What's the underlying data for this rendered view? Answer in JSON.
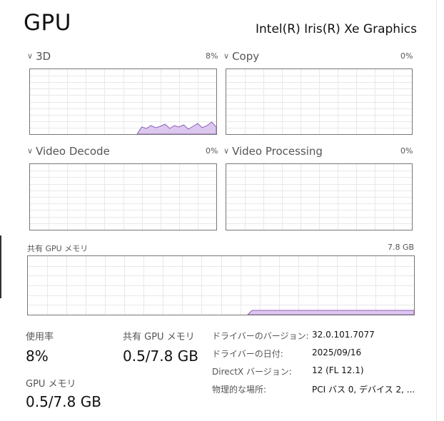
{
  "header": {
    "title": "GPU",
    "device_name": "Intel(R) Iris(R) Xe Graphics"
  },
  "engines": [
    {
      "label": "3D",
      "percent": "8%",
      "usage": [
        0,
        0,
        0,
        0,
        0,
        0,
        0,
        0,
        0,
        0,
        0,
        0,
        0,
        0,
        0,
        0,
        0,
        0,
        0,
        0,
        0,
        0,
        0,
        0,
        0,
        0,
        0,
        0,
        0,
        0,
        0,
        0,
        0,
        0,
        0,
        0,
        0,
        0,
        0,
        0,
        0,
        0,
        0,
        0,
        0,
        0,
        0,
        0,
        0,
        0,
        0,
        0,
        0,
        0,
        0,
        0,
        0,
        0,
        0,
        0,
        0,
        0,
        0,
        0,
        0,
        0,
        0,
        0,
        0,
        0,
        0,
        0,
        0,
        0,
        0,
        0,
        0,
        0,
        0,
        0,
        0,
        0,
        0,
        0,
        0,
        0,
        0,
        0,
        0,
        0,
        0,
        0,
        0,
        0,
        0,
        0,
        0,
        0,
        0,
        0,
        0,
        0,
        0,
        0,
        0,
        0,
        0,
        0,
        0,
        0,
        0,
        0,
        0,
        0,
        0,
        0,
        0,
        0,
        0,
        0,
        0,
        0,
        0,
        0,
        0,
        0,
        0,
        0,
        0,
        0,
        0,
        0,
        0,
        0,
        0,
        0,
        0,
        0,
        0,
        0,
        0,
        0,
        0,
        0,
        0,
        0,
        0,
        0,
        0,
        0,
        0,
        0,
        0,
        0,
        0,
        0,
        0,
        0,
        0,
        0,
        0,
        0,
        0,
        0,
        0,
        0,
        0,
        0,
        0,
        0,
        0,
        0,
        0,
        0,
        0,
        0,
        0,
        0,
        0,
        0,
        0,
        0,
        0,
        0,
        0,
        0,
        0,
        0,
        0,
        0,
        0,
        0,
        0,
        0,
        0,
        0,
        0,
        0,
        0,
        0,
        0,
        0,
        0,
        0,
        0,
        0,
        0,
        0,
        0,
        0,
        0,
        0,
        0,
        0,
        0,
        0,
        0,
        0,
        0,
        0,
        0,
        0,
        0,
        0,
        0,
        0,
        0,
        0,
        0,
        0,
        0,
        0,
        0,
        0,
        0,
        0,
        0,
        0,
        0,
        0,
        0,
        0,
        0,
        0,
        0,
        0,
        0,
        0,
        0,
        0,
        0,
        0,
        0,
        0,
        0,
        0,
        0,
        0,
        0,
        0,
        0,
        0
      ]
    },
    {
      "label": "Copy",
      "percent": "0%"
    },
    {
      "label": "Video Decode",
      "percent": "0%"
    },
    {
      "label": "Video Processing",
      "percent": "0%"
    }
  ],
  "shared_memory": {
    "label": "共有 GPU メモリ",
    "capacity": "7.8 GB"
  },
  "stats": {
    "utilization_label": "使用率",
    "utilization_value": "8%",
    "gpu_memory_label": "GPU メモリ",
    "gpu_memory_value": "0.5/7.8 GB",
    "shared_memory_label": "共有 GPU メモリ",
    "shared_memory_value": "0.5/7.8 GB"
  },
  "details": [
    {
      "key": "ドライバーのバージョン:",
      "value": "32.0.101.7077"
    },
    {
      "key": "ドライバーの日付:",
      "value": "2025/09/16"
    },
    {
      "key": "DirectX バージョン:",
      "value": "12 (FL 12.1)"
    },
    {
      "key": "物理的な場所:",
      "value": "PCI バス 0, デバイス 2, ..."
    }
  ],
  "colors": {
    "accent_line": "#8e5fb8",
    "accent_fill": "#dcc7ee",
    "grid": "#e8e8e8",
    "border": "#777777"
  }
}
